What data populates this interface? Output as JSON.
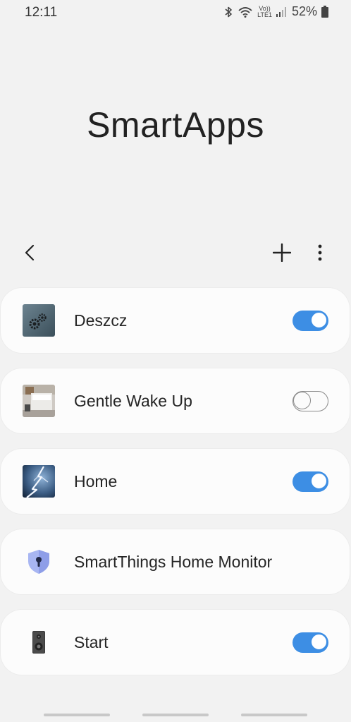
{
  "status_bar": {
    "time": "12:11",
    "lte_top": "Vo))",
    "lte_bottom": "LTE1",
    "battery": "52%",
    "icons": [
      "bluetooth-icon",
      "wifi-icon",
      "volte-icon",
      "signal-icon",
      "battery-icon"
    ]
  },
  "header": {
    "title": "SmartApps"
  },
  "toolbar": {
    "icons": [
      "back-arrow-icon",
      "plus-icon",
      "more-vertical-icon"
    ]
  },
  "apps": [
    {
      "name": "Deszcz",
      "icon": "gears-icon",
      "toggle": true,
      "has_toggle": true
    },
    {
      "name": "Gentle Wake Up",
      "icon": "bedroom-photo-icon",
      "toggle": false,
      "has_toggle": true
    },
    {
      "name": "Home",
      "icon": "lightning-icon",
      "toggle": true,
      "has_toggle": true
    },
    {
      "name": "SmartThings Home Monitor",
      "icon": "shield-lock-icon",
      "has_toggle": false
    },
    {
      "name": "Start",
      "icon": "speaker-icon",
      "toggle": true,
      "has_toggle": true
    }
  ],
  "colors": {
    "background": "#f2f2f2",
    "card": "#fcfcfc",
    "toggle_on": "#3d8ee4",
    "toggle_off_border": "#8a8a8a"
  }
}
